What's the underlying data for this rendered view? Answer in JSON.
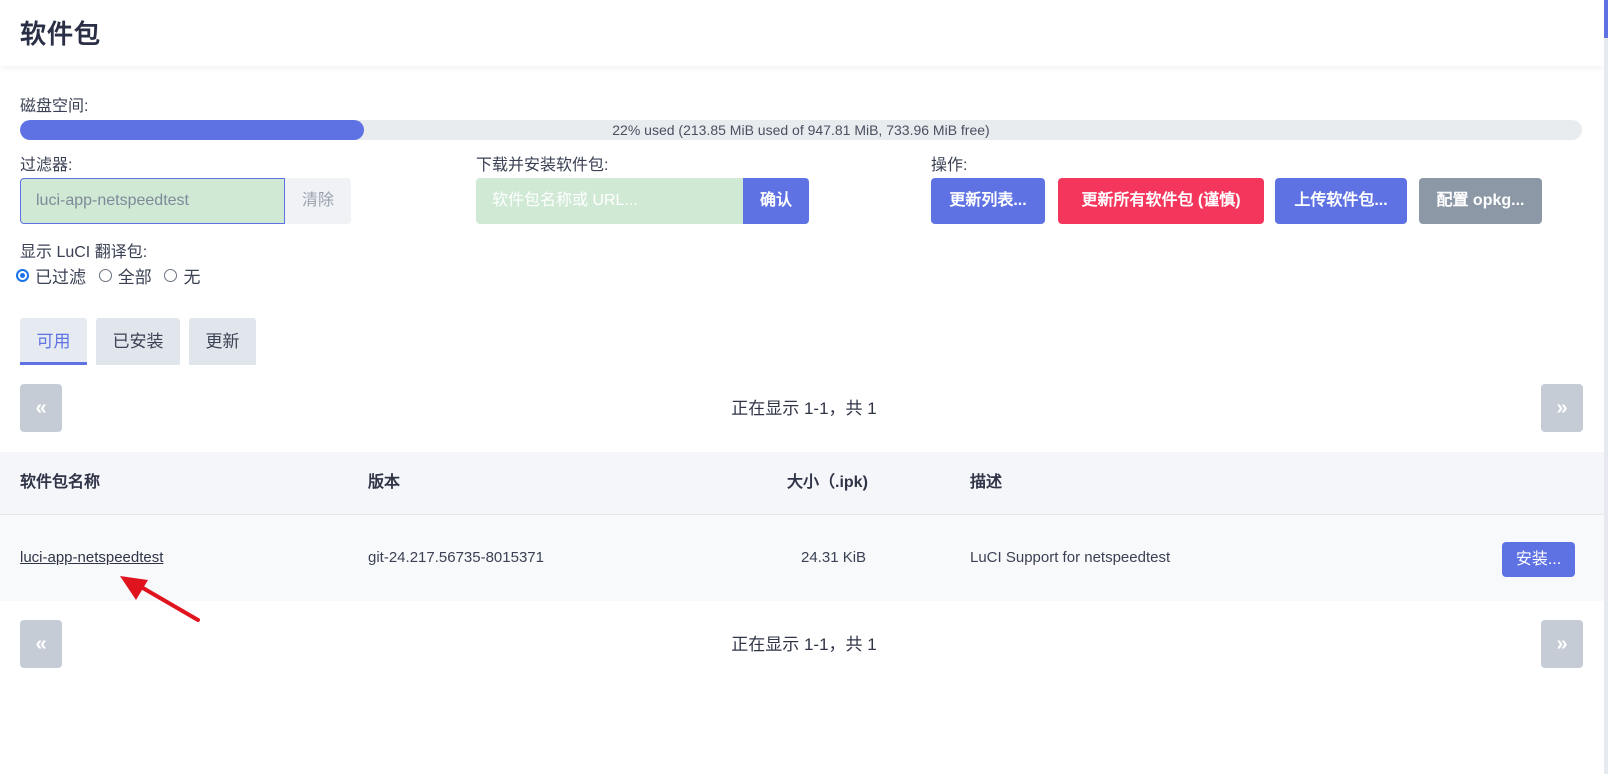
{
  "header": {
    "title": "软件包"
  },
  "disk": {
    "label": "磁盘空间:",
    "used_fraction": 0.22,
    "usage_text": "22% used (213.85 MiB used of 947.81 MiB, 733.96 MiB free)"
  },
  "filter": {
    "label": "过滤器:",
    "value": "luci-app-netspeedtest",
    "clear_label": "清除"
  },
  "download": {
    "label": "下载并安装软件包:",
    "placeholder": "软件包名称或 URL...",
    "confirm_label": "确认"
  },
  "actions": {
    "label": "操作:",
    "update_lists": "更新列表...",
    "upgrade_all": "更新所有软件包 (谨慎)",
    "upload": "上传软件包...",
    "configure": "配置 opkg..."
  },
  "translations": {
    "label": "显示 LuCI 翻译包:",
    "options": [
      {
        "label": "已过滤",
        "selected": true
      },
      {
        "label": "全部",
        "selected": false
      },
      {
        "label": "无",
        "selected": false
      }
    ]
  },
  "tabs": [
    {
      "label": "可用",
      "active": true
    },
    {
      "label": "已安装",
      "active": false
    },
    {
      "label": "更新",
      "active": false
    }
  ],
  "pager": {
    "prev": "«",
    "next": "»",
    "status": "正在显示 1-1，共 1"
  },
  "table": {
    "columns": [
      "软件包名称",
      "版本",
      "大小（.ipk)",
      "描述"
    ],
    "rows": [
      {
        "name": "luci-app-netspeedtest",
        "version": "git-24.217.56735-8015371",
        "size": "24.31 KiB",
        "description": "LuCI Support for netspeedtest",
        "action": "安装..."
      }
    ]
  },
  "colors": {
    "primary": "#5e72e4",
    "danger": "#f5365c",
    "secondary": "#8d98a6",
    "input_bg": "#cfe9d5",
    "annotation_arrow": "#e0141e"
  },
  "icons": [
    "annotation-arrow-icon"
  ]
}
